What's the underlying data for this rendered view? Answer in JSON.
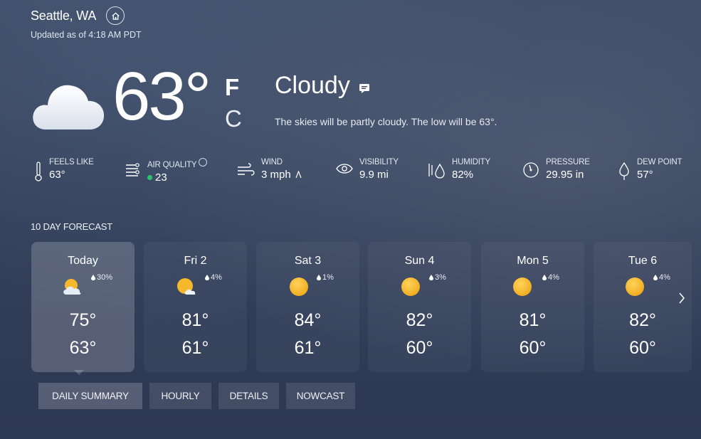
{
  "location": {
    "name": "Seattle, WA",
    "updated": "Updated as of 4:18 AM PDT",
    "home_icon": "home-icon"
  },
  "current": {
    "temp": "63°",
    "unit_f": "F",
    "unit_c": "C",
    "condition": "Cloudy",
    "description": "The skies will be partly cloudy. The low will be 63°.",
    "icon": "cloud-icon"
  },
  "metrics": [
    {
      "label": "FEELS LIKE",
      "value": "63°",
      "icon": "thermometer-icon"
    },
    {
      "label": "AIR QUALITY",
      "value": "23",
      "icon": "air-quality-icon",
      "status_color": "#2fc46b"
    },
    {
      "label": "WIND",
      "value": "3 mph",
      "icon": "wind-icon"
    },
    {
      "label": "VISIBILITY",
      "value": "9.9 mi",
      "icon": "eye-icon"
    },
    {
      "label": "HUMIDITY",
      "value": "82%",
      "icon": "humidity-icon"
    },
    {
      "label": "PRESSURE",
      "value": "29.95 in",
      "icon": "pressure-icon"
    },
    {
      "label": "DEW POINT",
      "value": "57°",
      "icon": "dew-point-icon"
    }
  ],
  "forecast": {
    "title": "10 DAY FORECAST",
    "days": [
      {
        "name": "Today",
        "precip": "30%",
        "hi": "75°",
        "lo": "63°",
        "icon": "partly-cloudy-icon"
      },
      {
        "name": "Fri 2",
        "precip": "4%",
        "hi": "81°",
        "lo": "61°",
        "icon": "mostly-sunny-icon"
      },
      {
        "name": "Sat 3",
        "precip": "1%",
        "hi": "84°",
        "lo": "61°",
        "icon": "sunny-icon"
      },
      {
        "name": "Sun 4",
        "precip": "3%",
        "hi": "82°",
        "lo": "60°",
        "icon": "sunny-icon"
      },
      {
        "name": "Mon 5",
        "precip": "4%",
        "hi": "81°",
        "lo": "60°",
        "icon": "sunny-icon"
      },
      {
        "name": "Tue 6",
        "precip": "4%",
        "hi": "82°",
        "lo": "60°",
        "icon": "sunny-icon"
      }
    ]
  },
  "tabs": [
    {
      "label": "DAILY SUMMARY",
      "active": true
    },
    {
      "label": "HOURLY",
      "active": false
    },
    {
      "label": "DETAILS",
      "active": false
    },
    {
      "label": "NOWCAST",
      "active": false
    }
  ],
  "colors": {
    "accent_sun": "#f5b82a",
    "aq_good": "#2fc46b",
    "background": "#34405a"
  }
}
